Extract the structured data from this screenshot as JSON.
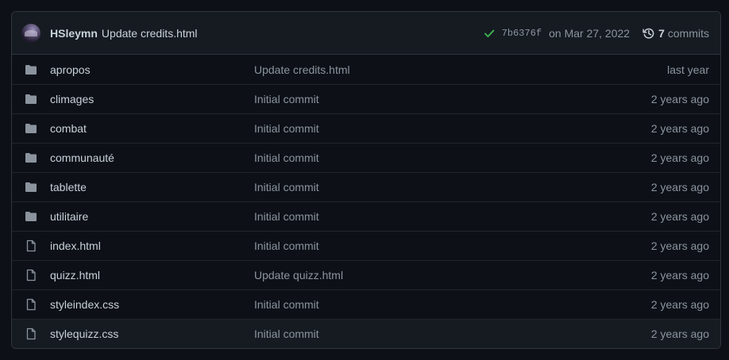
{
  "commit": {
    "author": "HSleymn",
    "message": "Update credits.html",
    "sha": "7b6376f",
    "date": "on Mar 27, 2022",
    "commit_count": "7",
    "commits_label": "commits"
  },
  "files": [
    {
      "type": "folder",
      "name": "apropos",
      "message": "Update credits.html",
      "age": "last year"
    },
    {
      "type": "folder",
      "name": "climages",
      "message": "Initial commit",
      "age": "2 years ago"
    },
    {
      "type": "folder",
      "name": "combat",
      "message": "Initial commit",
      "age": "2 years ago"
    },
    {
      "type": "folder",
      "name": "communauté",
      "message": "Initial commit",
      "age": "2 years ago"
    },
    {
      "type": "folder",
      "name": "tablette",
      "message": "Initial commit",
      "age": "2 years ago"
    },
    {
      "type": "folder",
      "name": "utilitaire",
      "message": "Initial commit",
      "age": "2 years ago"
    },
    {
      "type": "file",
      "name": "index.html",
      "message": "Initial commit",
      "age": "2 years ago"
    },
    {
      "type": "file",
      "name": "quizz.html",
      "message": "Update quizz.html",
      "age": "2 years ago"
    },
    {
      "type": "file",
      "name": "styleindex.css",
      "message": "Initial commit",
      "age": "2 years ago"
    },
    {
      "type": "file",
      "name": "stylequizz.css",
      "message": "Initial commit",
      "age": "2 years ago"
    }
  ]
}
